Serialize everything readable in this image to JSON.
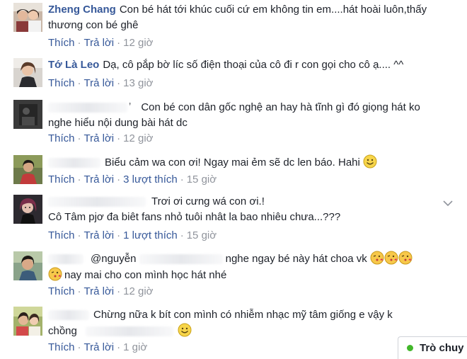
{
  "actions": {
    "like": "Thích",
    "reply": "Trả lời",
    "dot": "·"
  },
  "comments": [
    {
      "author": "Zheng Chang",
      "text": "Con bé hát tới khúc cuối cứ em không tin em....hát hoài luôn,thấy thương con bé ghê",
      "time": "12 giờ"
    },
    {
      "author": "Tớ Là Leo",
      "text": "Dạ, cô pắp bờ líc số điện thoại của cô đi r con gọi cho cô ạ.... ^^",
      "time": "13 giờ"
    },
    {
      "author_trailing": "ʼ",
      "text_line1": "Con bé con dân gốc nghệ an hay hà tĩnh gì đó giọng hát ko",
      "text_line2": "nghe hiểu nội dung bài hát dc",
      "time": "12 giờ"
    },
    {
      "text": "Biểu cảm wa con ơi! Ngay mai ẻm sẽ dc len báo. Hahi",
      "likes": "3 lượt thích",
      "time": "15 giờ"
    },
    {
      "text_line1": "Trơi ơi cưng wá con ơi.!",
      "text_line2": "Cô Tâm pjơ đa biêt fans nhỏ tuôi nhât la bao nhiêu chưa...???",
      "likes": "1 lượt thích",
      "time": "15 giờ"
    },
    {
      "mention": "@nguyễn",
      "text_line1": "nghe ngay bé này hát choa vk",
      "text_line2": "nay mai cho con mình học hát nhé",
      "time": "12 giờ"
    },
    {
      "text_line1": "Chừng nữa k bít con mình có nhiễm nhạc mỹ tâm giống e vậy k",
      "text_line2": "chồng",
      "time": "1 giờ"
    }
  ],
  "chat": {
    "label": "Trò chuy"
  },
  "colors": {
    "author": "#365899",
    "link": "#365899",
    "muted": "#90949c",
    "online": "#42b72a"
  }
}
